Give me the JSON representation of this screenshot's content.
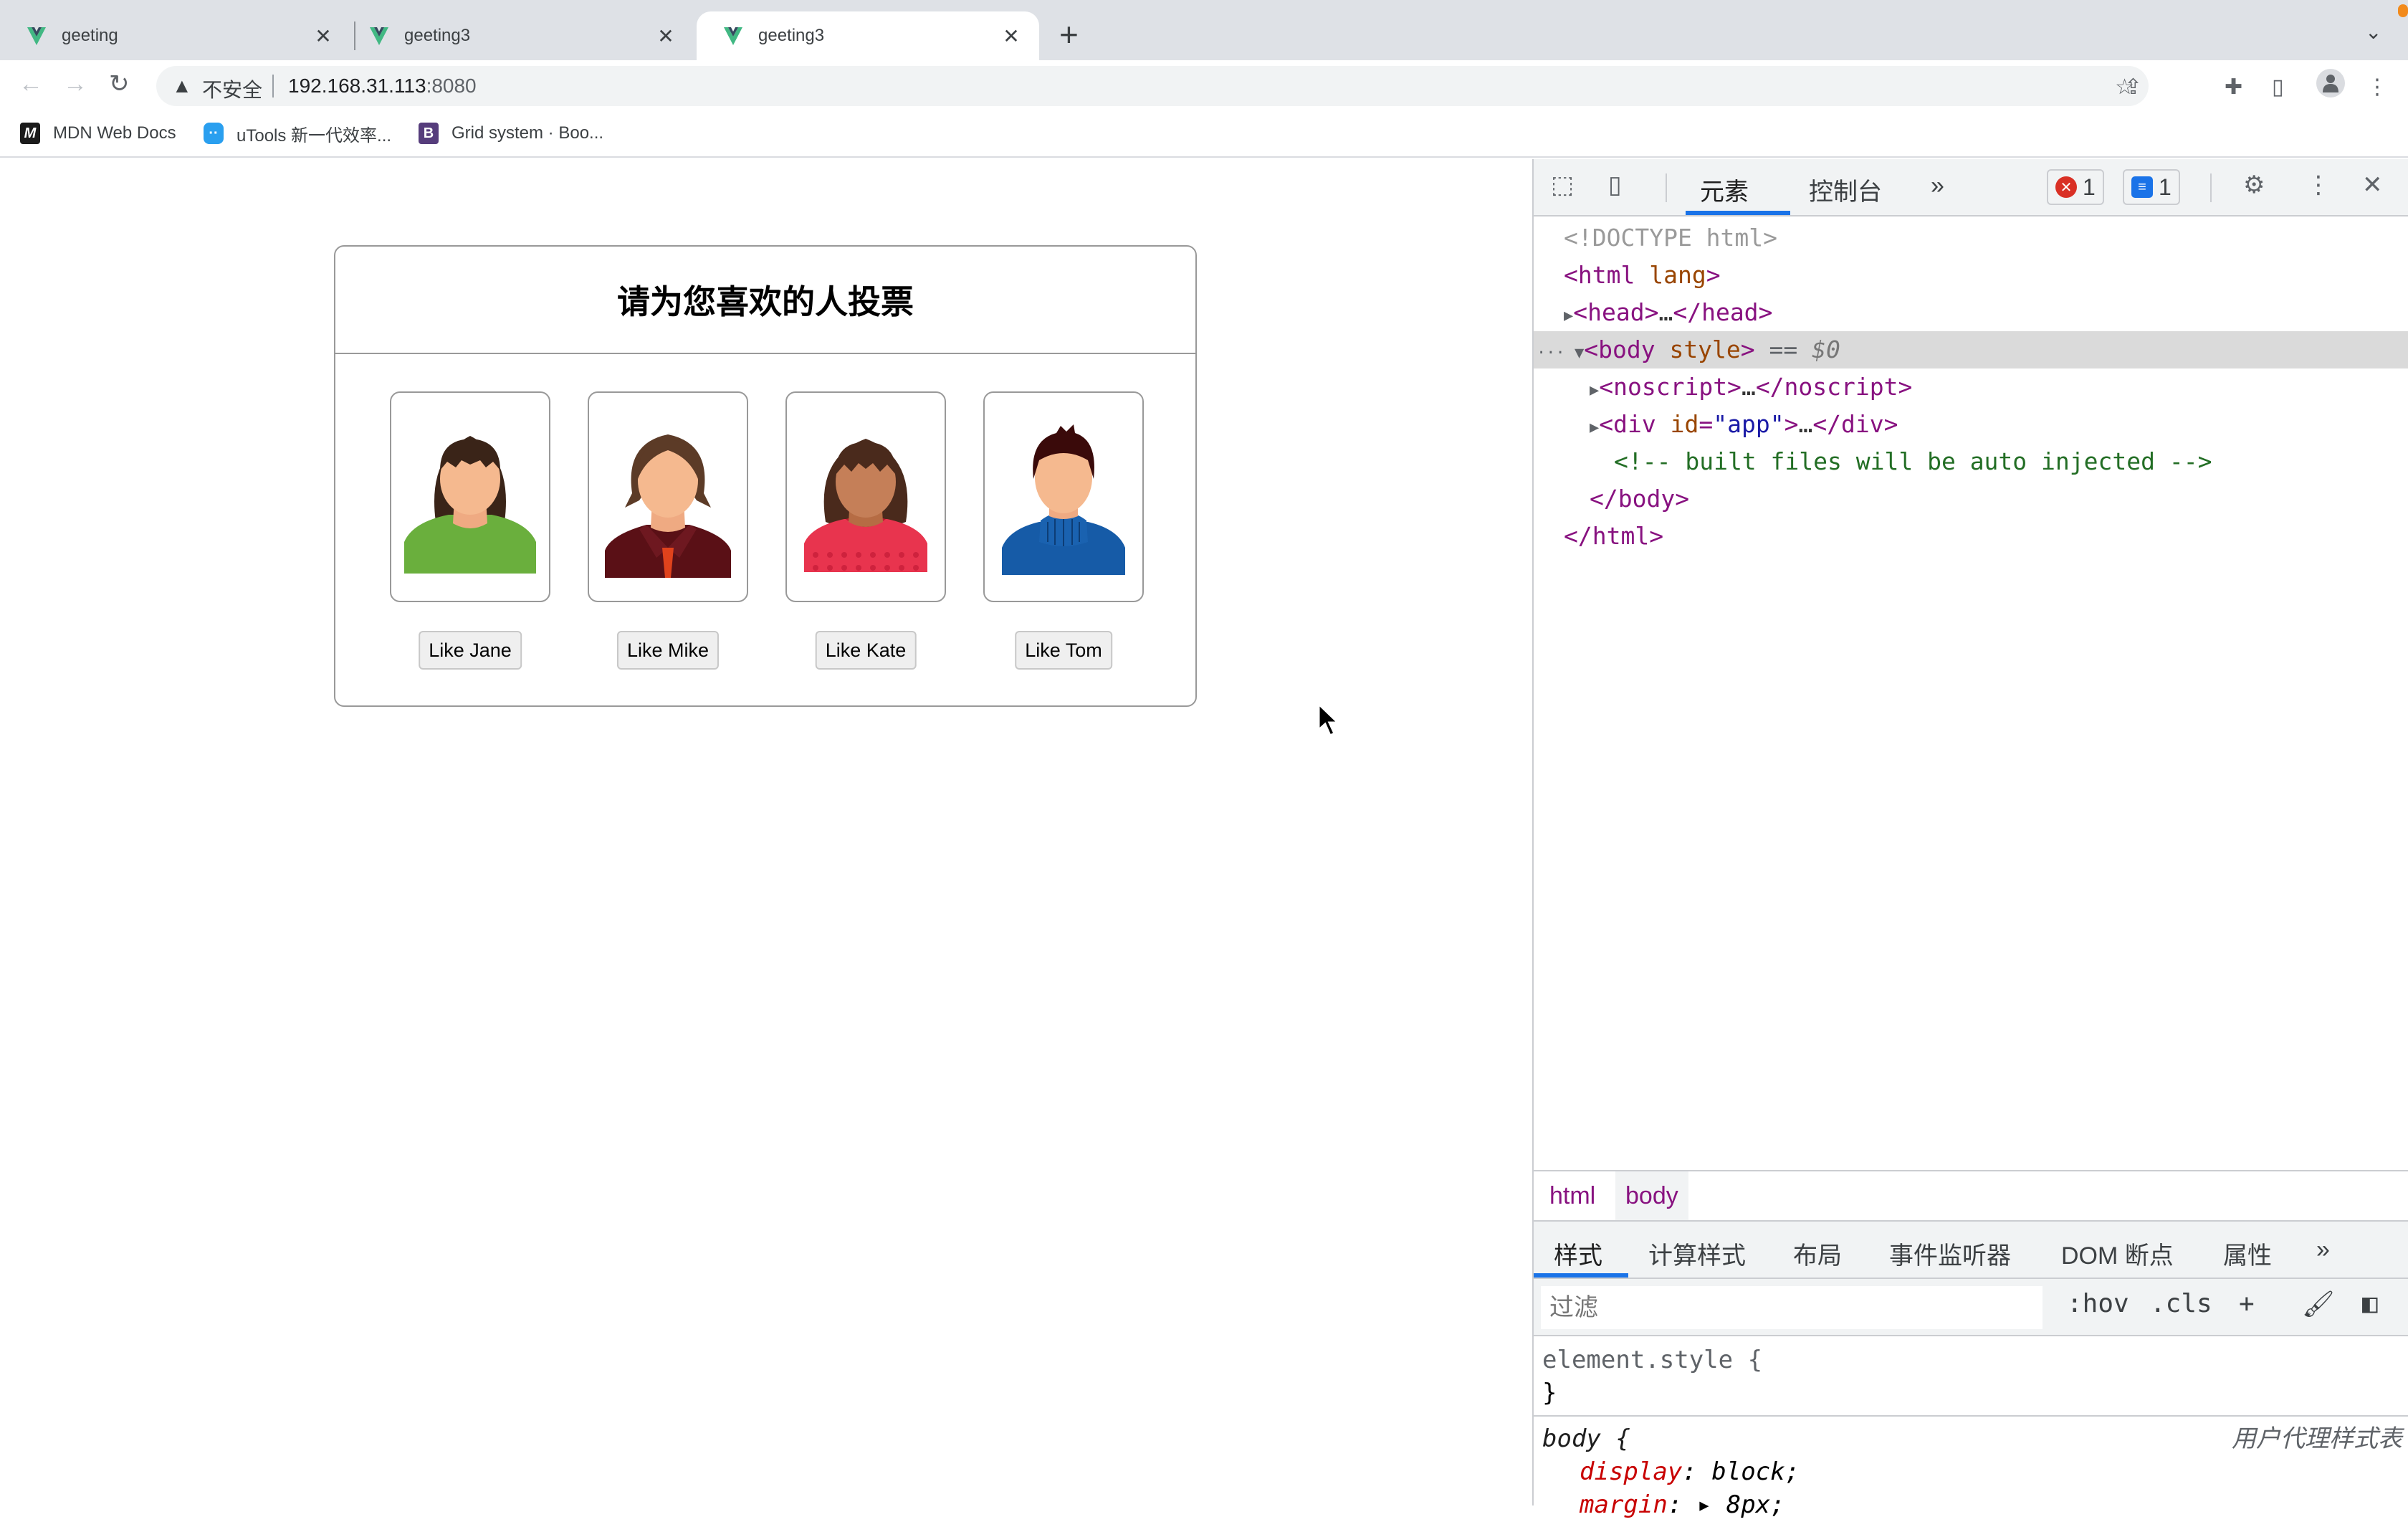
{
  "browser": {
    "tabs": [
      {
        "title": "geeting",
        "active": false
      },
      {
        "title": "geeting3",
        "active": false
      },
      {
        "title": "geeting3",
        "active": true
      }
    ],
    "new_tab_icon": "plus-icon",
    "tab_search_icon": "chevron-down-icon",
    "address": {
      "security_label": "不安全",
      "host": "192.168.31.113",
      "port": ":8080"
    },
    "bookmarks": [
      {
        "label": "MDN Web Docs",
        "icon": "mdn-icon"
      },
      {
        "label": "uTools 新一代效率...",
        "icon": "utools-icon"
      },
      {
        "label": "Grid system · Boo...",
        "icon": "bootstrap-icon"
      }
    ]
  },
  "page": {
    "title": "请为您喜欢的人投票",
    "candidates": [
      {
        "name": "Jane",
        "button": "Like Jane",
        "hair": "#3a2418",
        "skin": "#f5b98f",
        "shirt": "#6aaf3d",
        "style": "female-bangs"
      },
      {
        "name": "Mike",
        "button": "Like Mike",
        "hair": "#5c3b27",
        "skin": "#f5b98f",
        "shirt": "#5a1016",
        "style": "male-shirt"
      },
      {
        "name": "Kate",
        "button": "Like Kate",
        "hair": "#4a2a1c",
        "skin": "#c57f58",
        "shirt": "#e8344e",
        "style": "female-sweater"
      },
      {
        "name": "Tom",
        "button": "Like Tom",
        "hair": "#3a0a0a",
        "skin": "#f5b98f",
        "shirt": "#165ba7",
        "style": "male-turtleneck"
      }
    ]
  },
  "devtools": {
    "tabs": [
      "元素",
      "控制台"
    ],
    "more_tabs": "»",
    "error_count": "1",
    "message_count": "1",
    "dom": [
      {
        "text": "<!DOCTYPE html>"
      },
      {
        "open": "<html",
        "attr": " lang",
        "close": ">"
      },
      {
        "open": "<head>",
        "ellipsis": "…",
        "end": "</head>"
      },
      {
        "open": "<body",
        "attr": " style",
        "close": ">",
        "suffix": " == ",
        "ref": "$0"
      },
      {
        "open": "<noscript>",
        "ellipsis": "…",
        "end": "</noscript>"
      },
      {
        "open": "<div",
        "attr": " id",
        "eq": "=",
        "val": "\"app\"",
        "close": ">",
        "ellipsis": "…",
        "end": "</div>"
      },
      {
        "comment": "<!-- built files will be auto injected -->"
      },
      {
        "text": "</body>"
      },
      {
        "text": "</html>"
      }
    ],
    "breadcrumbs": [
      "html",
      "body"
    ],
    "styles_tabs": [
      "样式",
      "计算样式",
      "布局",
      "事件监听器",
      "DOM 断点",
      "属性"
    ],
    "filter_placeholder": "过滤",
    "filter_buttons": [
      ":hov",
      ".cls",
      "+"
    ],
    "rules": {
      "element_style": "element.style {",
      "element_close": "}",
      "body_selector": "body {",
      "body_source": "用户代理样式表",
      "body_props": [
        {
          "prop": "display",
          "value": "block;"
        },
        {
          "prop": "margin",
          "value": "▸ 8px;"
        }
      ]
    }
  }
}
